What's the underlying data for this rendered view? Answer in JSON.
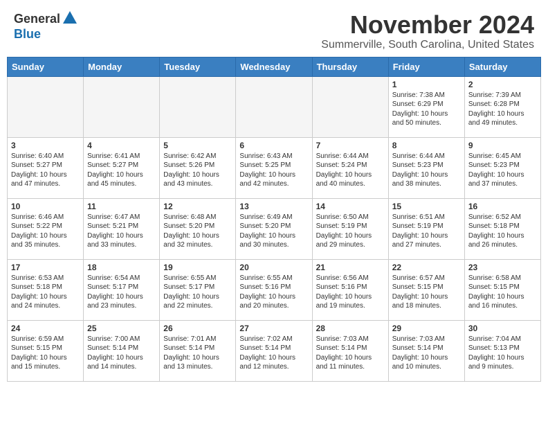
{
  "logo": {
    "general": "General",
    "blue": "Blue"
  },
  "header": {
    "month": "November 2024",
    "location": "Summerville, South Carolina, United States"
  },
  "days_of_week": [
    "Sunday",
    "Monday",
    "Tuesday",
    "Wednesday",
    "Thursday",
    "Friday",
    "Saturday"
  ],
  "weeks": [
    [
      {
        "day": "",
        "info": ""
      },
      {
        "day": "",
        "info": ""
      },
      {
        "day": "",
        "info": ""
      },
      {
        "day": "",
        "info": ""
      },
      {
        "day": "",
        "info": ""
      },
      {
        "day": "1",
        "info": "Sunrise: 7:38 AM\nSunset: 6:29 PM\nDaylight: 10 hours and 50 minutes."
      },
      {
        "day": "2",
        "info": "Sunrise: 7:39 AM\nSunset: 6:28 PM\nDaylight: 10 hours and 49 minutes."
      }
    ],
    [
      {
        "day": "3",
        "info": "Sunrise: 6:40 AM\nSunset: 5:27 PM\nDaylight: 10 hours and 47 minutes."
      },
      {
        "day": "4",
        "info": "Sunrise: 6:41 AM\nSunset: 5:27 PM\nDaylight: 10 hours and 45 minutes."
      },
      {
        "day": "5",
        "info": "Sunrise: 6:42 AM\nSunset: 5:26 PM\nDaylight: 10 hours and 43 minutes."
      },
      {
        "day": "6",
        "info": "Sunrise: 6:43 AM\nSunset: 5:25 PM\nDaylight: 10 hours and 42 minutes."
      },
      {
        "day": "7",
        "info": "Sunrise: 6:44 AM\nSunset: 5:24 PM\nDaylight: 10 hours and 40 minutes."
      },
      {
        "day": "8",
        "info": "Sunrise: 6:44 AM\nSunset: 5:23 PM\nDaylight: 10 hours and 38 minutes."
      },
      {
        "day": "9",
        "info": "Sunrise: 6:45 AM\nSunset: 5:23 PM\nDaylight: 10 hours and 37 minutes."
      }
    ],
    [
      {
        "day": "10",
        "info": "Sunrise: 6:46 AM\nSunset: 5:22 PM\nDaylight: 10 hours and 35 minutes."
      },
      {
        "day": "11",
        "info": "Sunrise: 6:47 AM\nSunset: 5:21 PM\nDaylight: 10 hours and 33 minutes."
      },
      {
        "day": "12",
        "info": "Sunrise: 6:48 AM\nSunset: 5:20 PM\nDaylight: 10 hours and 32 minutes."
      },
      {
        "day": "13",
        "info": "Sunrise: 6:49 AM\nSunset: 5:20 PM\nDaylight: 10 hours and 30 minutes."
      },
      {
        "day": "14",
        "info": "Sunrise: 6:50 AM\nSunset: 5:19 PM\nDaylight: 10 hours and 29 minutes."
      },
      {
        "day": "15",
        "info": "Sunrise: 6:51 AM\nSunset: 5:19 PM\nDaylight: 10 hours and 27 minutes."
      },
      {
        "day": "16",
        "info": "Sunrise: 6:52 AM\nSunset: 5:18 PM\nDaylight: 10 hours and 26 minutes."
      }
    ],
    [
      {
        "day": "17",
        "info": "Sunrise: 6:53 AM\nSunset: 5:18 PM\nDaylight: 10 hours and 24 minutes."
      },
      {
        "day": "18",
        "info": "Sunrise: 6:54 AM\nSunset: 5:17 PM\nDaylight: 10 hours and 23 minutes."
      },
      {
        "day": "19",
        "info": "Sunrise: 6:55 AM\nSunset: 5:17 PM\nDaylight: 10 hours and 22 minutes."
      },
      {
        "day": "20",
        "info": "Sunrise: 6:55 AM\nSunset: 5:16 PM\nDaylight: 10 hours and 20 minutes."
      },
      {
        "day": "21",
        "info": "Sunrise: 6:56 AM\nSunset: 5:16 PM\nDaylight: 10 hours and 19 minutes."
      },
      {
        "day": "22",
        "info": "Sunrise: 6:57 AM\nSunset: 5:15 PM\nDaylight: 10 hours and 18 minutes."
      },
      {
        "day": "23",
        "info": "Sunrise: 6:58 AM\nSunset: 5:15 PM\nDaylight: 10 hours and 16 minutes."
      }
    ],
    [
      {
        "day": "24",
        "info": "Sunrise: 6:59 AM\nSunset: 5:15 PM\nDaylight: 10 hours and 15 minutes."
      },
      {
        "day": "25",
        "info": "Sunrise: 7:00 AM\nSunset: 5:14 PM\nDaylight: 10 hours and 14 minutes."
      },
      {
        "day": "26",
        "info": "Sunrise: 7:01 AM\nSunset: 5:14 PM\nDaylight: 10 hours and 13 minutes."
      },
      {
        "day": "27",
        "info": "Sunrise: 7:02 AM\nSunset: 5:14 PM\nDaylight: 10 hours and 12 minutes."
      },
      {
        "day": "28",
        "info": "Sunrise: 7:03 AM\nSunset: 5:14 PM\nDaylight: 10 hours and 11 minutes."
      },
      {
        "day": "29",
        "info": "Sunrise: 7:03 AM\nSunset: 5:14 PM\nDaylight: 10 hours and 10 minutes."
      },
      {
        "day": "30",
        "info": "Sunrise: 7:04 AM\nSunset: 5:13 PM\nDaylight: 10 hours and 9 minutes."
      }
    ]
  ]
}
